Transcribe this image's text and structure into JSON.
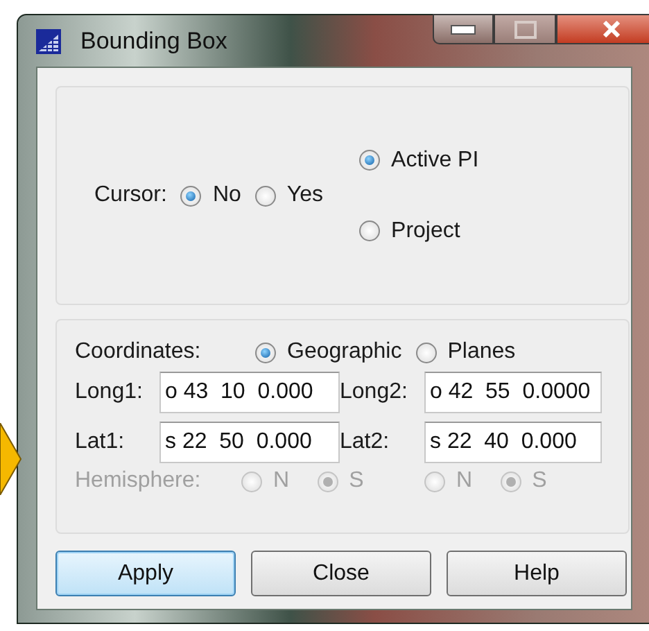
{
  "window": {
    "title": "Bounding Box"
  },
  "cursor": {
    "label": "Cursor:",
    "options": [
      {
        "label": "No",
        "selected": true
      },
      {
        "label": "Yes",
        "selected": false
      }
    ]
  },
  "target": {
    "options": [
      {
        "label": "Active PI",
        "selected": true
      },
      {
        "label": "Project",
        "selected": false
      }
    ]
  },
  "coordinates": {
    "label": "Coordinates:",
    "options": [
      {
        "label": "Geographic",
        "selected": true
      },
      {
        "label": "Planes",
        "selected": false
      }
    ]
  },
  "fields": [
    {
      "label": "Long1:",
      "value": "o 43  10  0.000"
    },
    {
      "label": "Long2:",
      "value": "o 42  55  0.0000"
    },
    {
      "label": "Lat1:",
      "value": "s 22  50  0.000"
    },
    {
      "label": "Lat2:",
      "value": "s 22  40  0.000"
    }
  ],
  "hemisphere": {
    "label": "Hemisphere:",
    "disabled": true,
    "groups": [
      [
        {
          "label": "N",
          "selected": false
        },
        {
          "label": "S",
          "selected": true
        }
      ],
      [
        {
          "label": "N",
          "selected": false
        },
        {
          "label": "S",
          "selected": true
        }
      ]
    ]
  },
  "buttons": [
    {
      "label": "Apply",
      "selected": true
    },
    {
      "label": "Close",
      "selected": false
    },
    {
      "label": "Help",
      "selected": false
    }
  ]
}
